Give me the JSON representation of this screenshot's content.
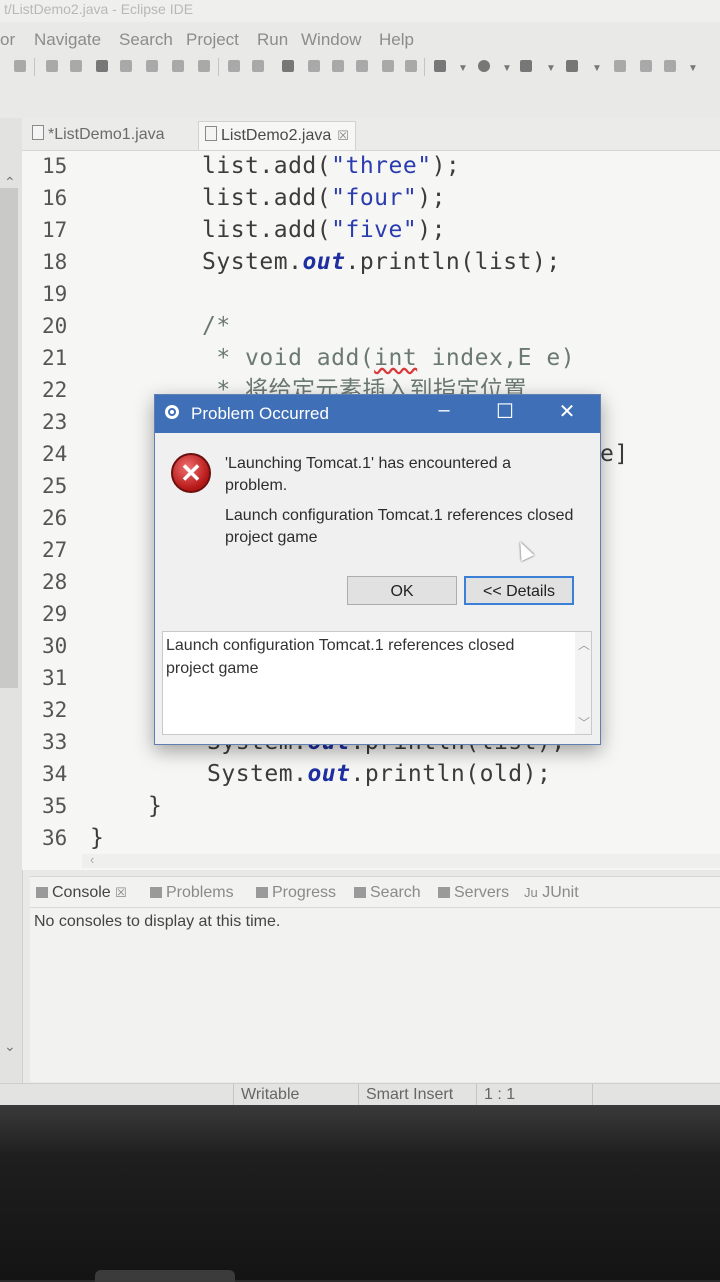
{
  "window": {
    "title": "t/ListDemo2.java - Eclipse IDE"
  },
  "menu": [
    "or",
    "Navigate",
    "Search",
    "Project",
    "Run",
    "Window",
    "Help"
  ],
  "editor": {
    "tabs": [
      {
        "label": "*ListDemo1.java",
        "active": false
      },
      {
        "label": "ListDemo2.java",
        "active": true,
        "close": "☒"
      }
    ],
    "lines": [
      {
        "num": "15",
        "code": [
          {
            "t": "list.add("
          },
          {
            "t": "\"three\"",
            "c": "str"
          },
          {
            "t": ");"
          }
        ]
      },
      {
        "num": "16",
        "code": [
          {
            "t": "list.add("
          },
          {
            "t": "\"four\"",
            "c": "str"
          },
          {
            "t": ");"
          }
        ]
      },
      {
        "num": "17",
        "code": [
          {
            "t": "list.add("
          },
          {
            "t": "\"five\"",
            "c": "str"
          },
          {
            "t": ");"
          }
        ]
      },
      {
        "num": "18",
        "code": [
          {
            "t": "System."
          },
          {
            "t": "out",
            "c": "fld"
          },
          {
            "t": ".println(list);"
          }
        ]
      },
      {
        "num": "19",
        "code": []
      },
      {
        "num": "20",
        "code": [
          {
            "t": "/*",
            "c": "cmt"
          }
        ]
      },
      {
        "num": "21",
        "code": [
          {
            "t": " * void add(",
            "c": "cmt"
          },
          {
            "t": "int",
            "c": "cmt sq"
          },
          {
            "t": " index,E e)",
            "c": "cmt"
          }
        ]
      },
      {
        "num": "22",
        "code": [
          {
            "t": " * 将给定元素插入到指定位置",
            "c": "cmt"
          }
        ]
      },
      {
        "num": "23",
        "code": []
      },
      {
        "num": "24",
        "code": []
      },
      {
        "num": "25",
        "code": []
      },
      {
        "num": "26",
        "code": []
      },
      {
        "num": "27",
        "code": []
      },
      {
        "num": "28",
        "code": []
      },
      {
        "num": "29",
        "code": []
      },
      {
        "num": "30",
        "code": []
      },
      {
        "num": "31",
        "code": []
      },
      {
        "num": "32",
        "code": []
      },
      {
        "num": "33",
        "code": [
          {
            "t": "System."
          },
          {
            "t": "out",
            "c": "fld"
          },
          {
            "t": ".println(list);"
          }
        ]
      },
      {
        "num": "34",
        "code": [
          {
            "t": "System."
          },
          {
            "t": "out",
            "c": "fld"
          },
          {
            "t": ".println(old);"
          }
        ]
      },
      {
        "num": "35",
        "code": [
          {
            "t": "}"
          }
        ]
      },
      {
        "num": "36",
        "code": [
          {
            "t": "}"
          }
        ]
      }
    ],
    "line24_tail": "e]"
  },
  "console": {
    "tabs": [
      {
        "label": "Console",
        "close": "☒",
        "active": true
      },
      {
        "label": "Problems"
      },
      {
        "label": "Progress"
      },
      {
        "label": "Search"
      },
      {
        "label": "Servers"
      },
      {
        "label": "JUnit",
        "prefix": "Ju"
      }
    ],
    "message": "No consoles to display at this time."
  },
  "status": {
    "writable": "Writable",
    "insert": "Smart Insert",
    "position": "1 : 1"
  },
  "dialog": {
    "title": "Problem Occurred",
    "message": "'Launching Tomcat.1' has encountered a problem.",
    "detail": "Launch configuration Tomcat.1 references closed project game",
    "ok": "OK",
    "details_button": "<< Details",
    "details_text": "Launch configuration Tomcat.1 references closed project game"
  }
}
